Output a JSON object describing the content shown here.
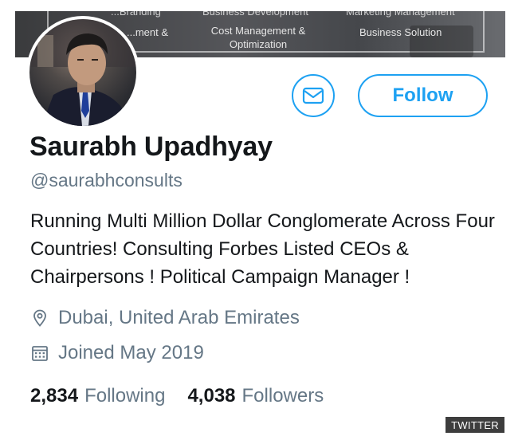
{
  "banner": {
    "top_items": [
      "...Branding",
      "Business Development",
      "Marketing Management"
    ],
    "left_item": "...ment &",
    "middle_item": "Cost Management & Optimization",
    "right_item": "Business Solution"
  },
  "profile": {
    "name": "Saurabh Upadhyay",
    "handle": "@saurabhconsults",
    "bio": "Running Multi Million Dollar Conglomerate Across Four Countries! Consulting Forbes Listed CEOs & Chairpersons ! Political Campaign Manager !",
    "location": "Dubai, United Arab Emirates",
    "joined": "Joined May 2019"
  },
  "actions": {
    "message_icon": "envelope-icon",
    "follow_label": "Follow"
  },
  "stats": {
    "following_count": "2,834",
    "following_label": "Following",
    "followers_count": "4,038",
    "followers_label": "Followers"
  },
  "credit": "TWITTER",
  "colors": {
    "accent": "#1da1f2",
    "text": "#14171a",
    "secondary": "#657786"
  }
}
